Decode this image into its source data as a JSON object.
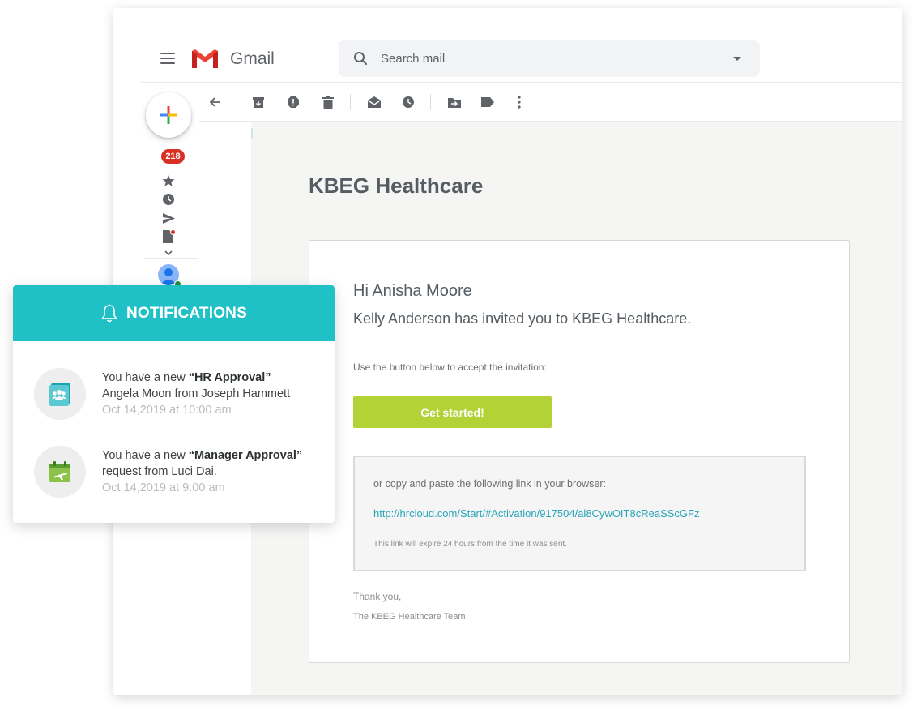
{
  "gmail": {
    "wordmark": "Gmail",
    "search": {
      "placeholder": "Search mail",
      "value": ""
    },
    "sidebar": {
      "unread_count": "218"
    },
    "toolbar_icons": [
      "back-arrow-icon",
      "archive-icon",
      "report-spam-icon",
      "delete-icon",
      "mark-unread-icon",
      "snooze-icon",
      "move-to-icon",
      "label-icon",
      "more-vert-icon"
    ]
  },
  "email": {
    "brand": "KBEG Healthcare",
    "greeting": "Hi Anisha Moore",
    "invite_line": "Kelly Anderson has invited you to KBEG Healthcare.",
    "instruction": "Use the button below to accept the invitation:",
    "cta_label": "Get started!",
    "link_intro": "or copy and paste the following link in your browser:",
    "activation_link": "http://hrcloud.com/Start/#Activation/917504/al8CywOIT8cReaSScGFz",
    "expiry_note": "This link will expire 24 hours from the time it was sent.",
    "thanks": "Thank you,",
    "team_sign": "The KBEG Healthcare Team"
  },
  "notifications": {
    "title": "NOTIFICATIONS",
    "items": [
      {
        "prefix": "You have a new ",
        "type": "“HR Approval”",
        "detail": "Angela Moon from Joseph Hammett",
        "time": "Oct 14,2019 at 10:00 am",
        "icon": "hr-approval-icon"
      },
      {
        "prefix": "You have a new ",
        "type": "“Manager Approval”",
        "detail": "request from Luci Dai.",
        "time": "Oct 14,2019 at 9:00 am",
        "icon": "manager-approval-icon"
      }
    ]
  },
  "colors": {
    "notif_header": "#20c0c7",
    "cta_button": "#b2d235",
    "link": "#2aa5b8",
    "badge": "#d93025"
  }
}
